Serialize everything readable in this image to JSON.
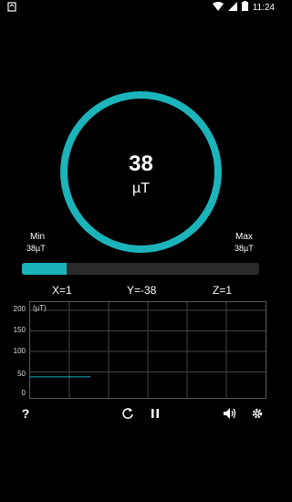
{
  "status_bar": {
    "time": "11:24",
    "icons": [
      "notification-icon",
      "wifi-icon",
      "signal-icon",
      "battery-icon"
    ]
  },
  "gauge": {
    "value": "38",
    "unit": "µT"
  },
  "range": {
    "min_label": "Min",
    "min_value": "38µT",
    "max_label": "Max",
    "max_value": "38µT",
    "progress_fraction": 0.19
  },
  "axes": {
    "x": "X=1",
    "y": "Y=-38",
    "z": "Z=1"
  },
  "chart_data": {
    "type": "line",
    "ylabel": "(µT)",
    "y_ticks": [
      "200",
      "150",
      "100",
      "50",
      "0"
    ],
    "ylim": [
      0,
      200
    ],
    "grid": true,
    "series": [
      {
        "values": [
          38,
          38
        ]
      }
    ]
  },
  "toolbar": {
    "help_label": "?",
    "icons": [
      "refresh-icon",
      "pause-icon",
      "volume-icon",
      "settings-icon"
    ]
  },
  "colors": {
    "accent": "#1cb4bb",
    "background": "#000000",
    "track": "#2a2a2a"
  }
}
